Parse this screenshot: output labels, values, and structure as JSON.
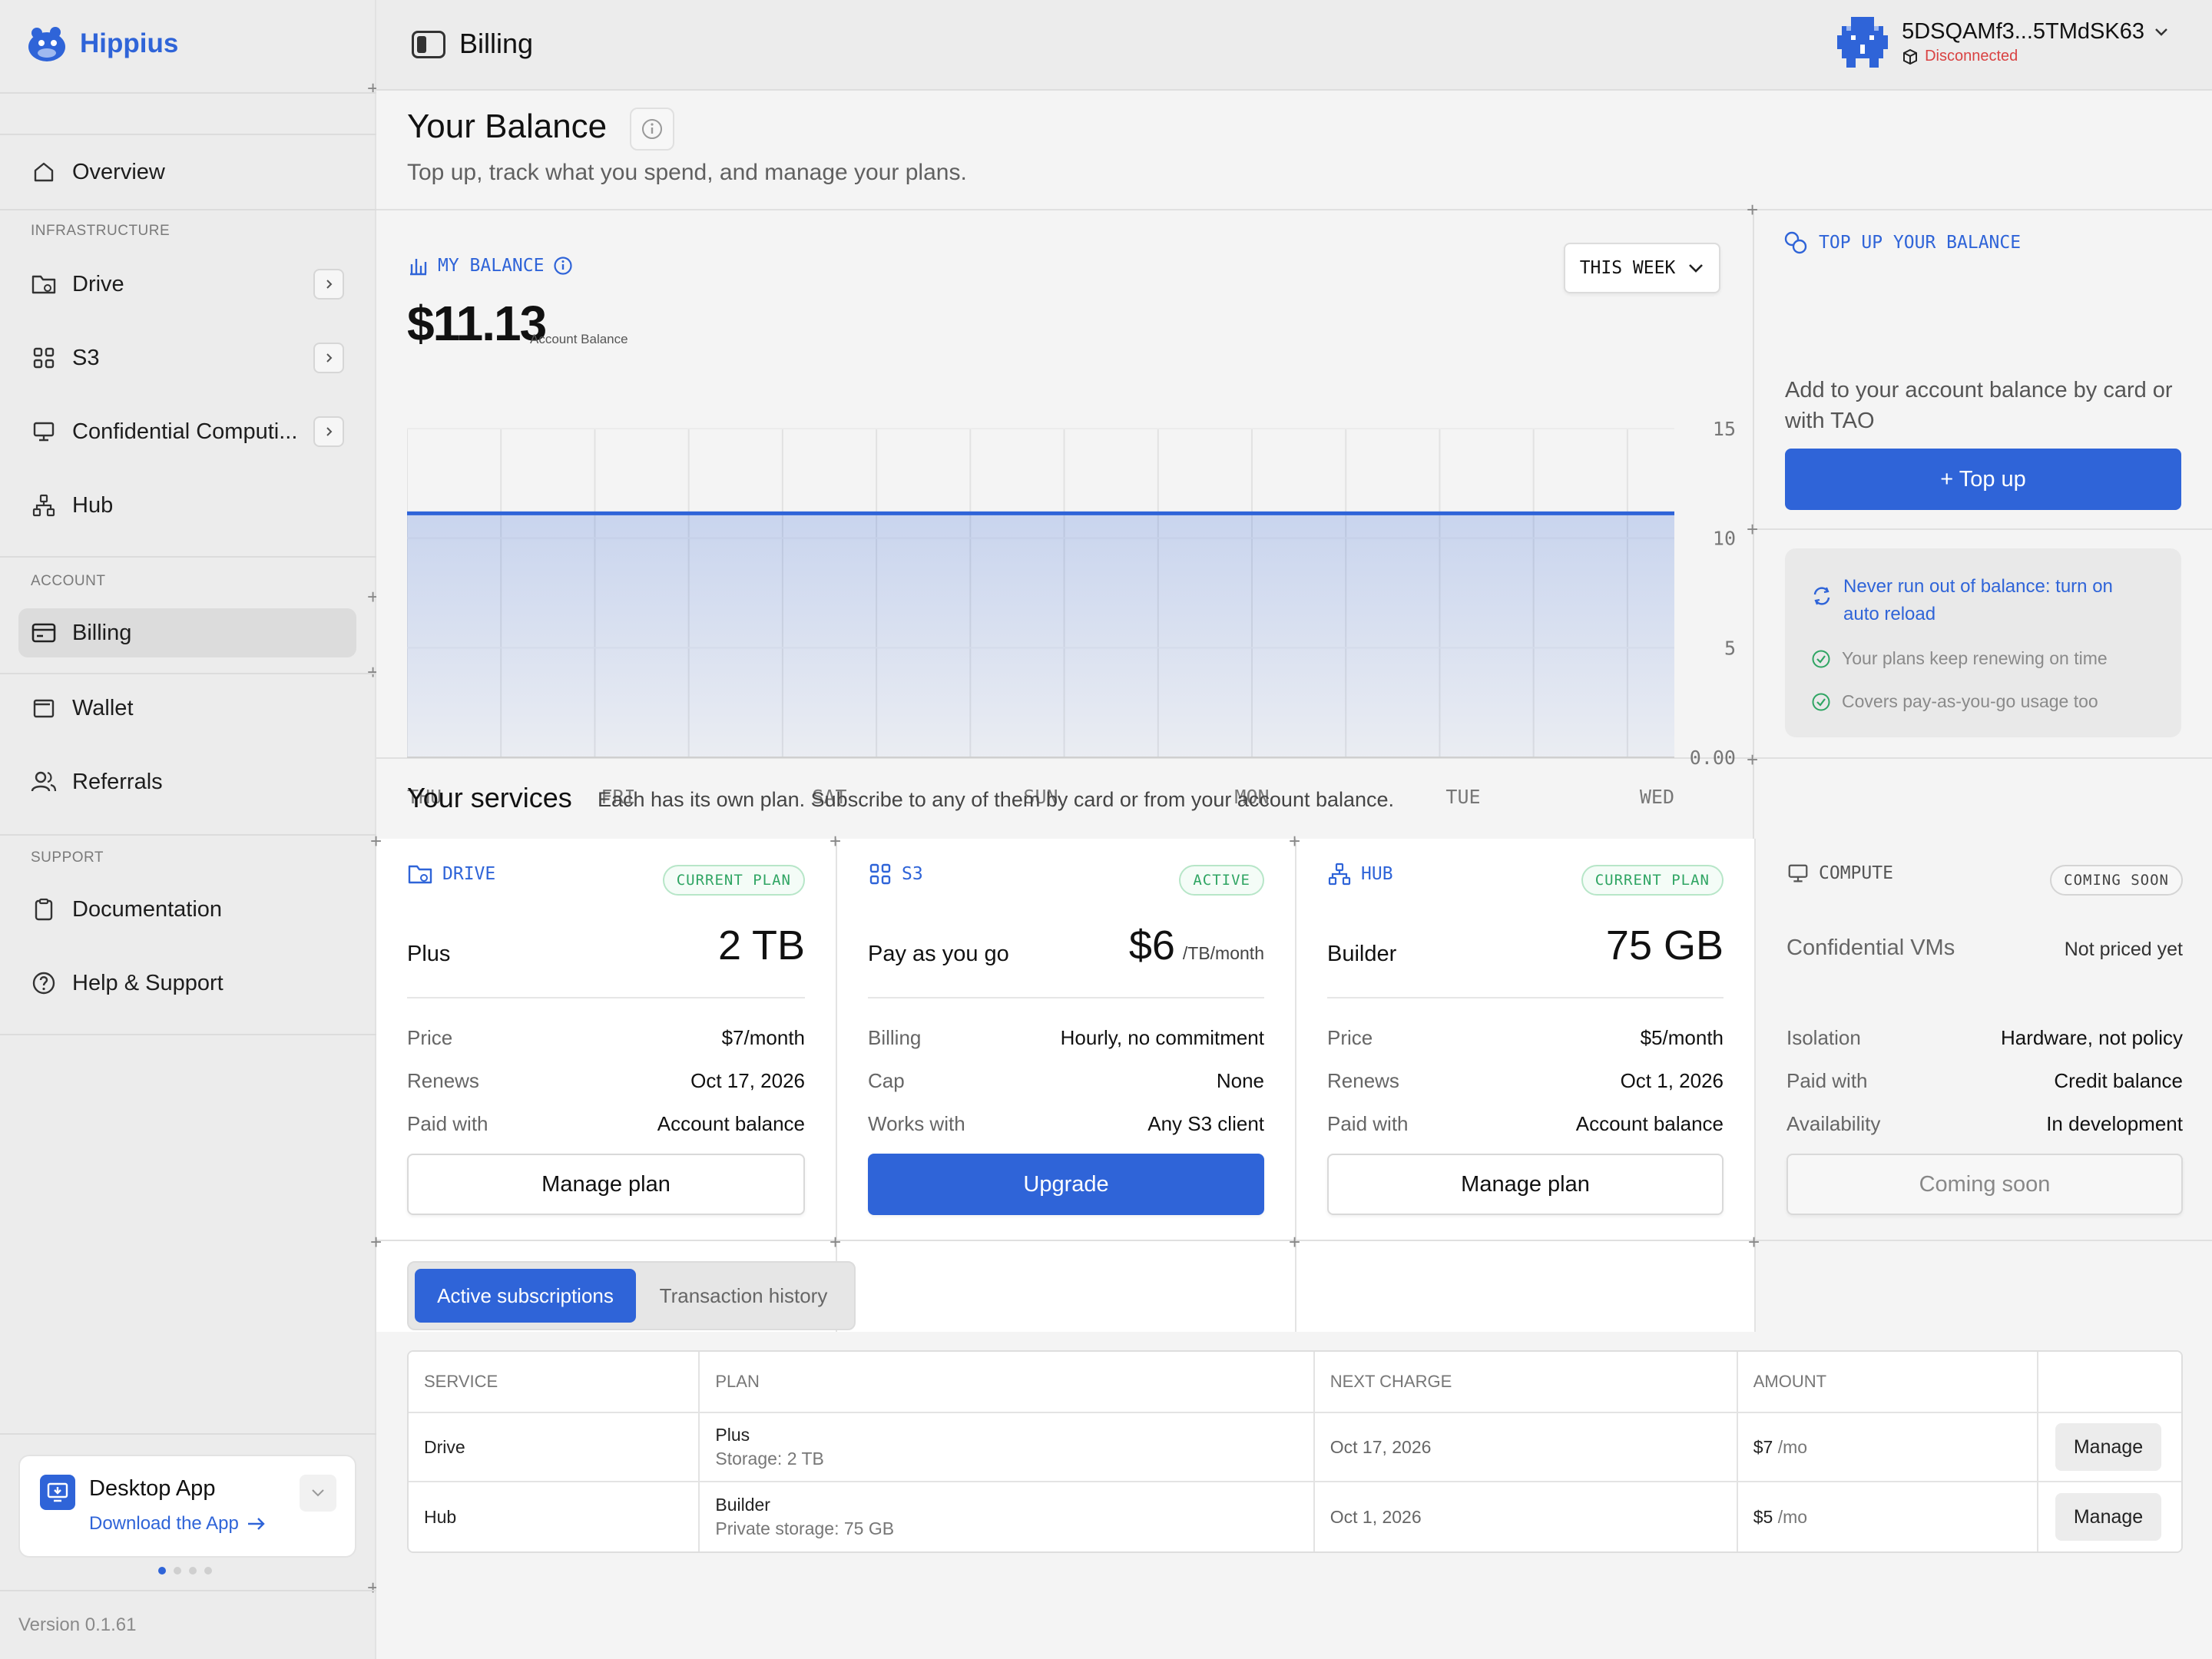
{
  "sidebar": {
    "brand": "Hippius",
    "items": [
      {
        "label": "Overview"
      },
      {
        "label": "Drive"
      },
      {
        "label": "S3"
      },
      {
        "label": "Confidential Computi..."
      },
      {
        "label": "Hub"
      },
      {
        "label": "Billing"
      },
      {
        "label": "Wallet"
      },
      {
        "label": "Referrals"
      },
      {
        "label": "Documentation"
      },
      {
        "label": "Help & Support"
      }
    ],
    "sections": {
      "infrastructure": "INFRASTRUCTURE",
      "account": "ACCOUNT",
      "support": "SUPPORT"
    },
    "desktop": {
      "title": "Desktop App",
      "link": "Download the App"
    },
    "version": "Version 0.1.61"
  },
  "topbar": {
    "title": "Billing",
    "address": "5DSQAMf3...5TMdSK63",
    "status": "Disconnected"
  },
  "page": {
    "title": "Your Balance",
    "subtitle": "Top up, track what you spend, and manage your plans."
  },
  "balance": {
    "label": "MY BALANCE",
    "value": "$11.13",
    "note": "Account Balance",
    "range": "THIS WEEK"
  },
  "chart_data": {
    "type": "area",
    "x": [
      "THU",
      "FRI",
      "SAT",
      "SUN",
      "MON",
      "TUE",
      "WED"
    ],
    "series": [
      {
        "values": [
          11.13,
          11.13,
          11.13,
          11.13,
          11.13,
          11.13,
          11.13
        ]
      }
    ],
    "ylim": [
      0,
      15
    ],
    "yticks": [
      "15",
      "10",
      "5",
      "0.00"
    ],
    "grid": true,
    "color": "#2f64d8"
  },
  "topup": {
    "label": "TOP UP YOUR BALANCE",
    "desc": "Add to your account balance by card or with TAO",
    "button": "+ Top up",
    "reload": "Never run out of balance: turn on auto reload",
    "bullets": [
      "Your plans keep renewing on time",
      "Covers pay-as-you-go usage too"
    ]
  },
  "services": {
    "title": "Your services",
    "subtitle": "Each has its own plan. Subscribe to any of them by card or from your account balance.",
    "cards": [
      {
        "name": "DRIVE",
        "badge": "CURRENT PLAN",
        "plan": "Plus",
        "amount": "2 TB",
        "unit": "",
        "rows": [
          [
            "Price",
            "$7/month"
          ],
          [
            "Renews",
            "Oct 17, 2026"
          ],
          [
            "Paid with",
            "Account balance"
          ]
        ],
        "button": "Manage plan"
      },
      {
        "name": "S3",
        "badge": "ACTIVE",
        "plan": "Pay as you go",
        "amount": "$6",
        "unit": "/TB/month",
        "rows": [
          [
            "Billing",
            "Hourly, no commitment"
          ],
          [
            "Cap",
            "None"
          ],
          [
            "Works with",
            "Any S3 client"
          ]
        ],
        "button": "Upgrade"
      },
      {
        "name": "HUB",
        "badge": "CURRENT PLAN",
        "plan": "Builder",
        "amount": "75 GB",
        "unit": "",
        "rows": [
          [
            "Price",
            "$5/month"
          ],
          [
            "Renews",
            "Oct 1, 2026"
          ],
          [
            "Paid with",
            "Account balance"
          ]
        ],
        "button": "Manage plan"
      },
      {
        "name": "COMPUTE",
        "badge": "COMING SOON",
        "plan": "Confidential VMs",
        "amount": "Not priced yet",
        "unit": "",
        "rows": [
          [
            "Isolation",
            "Hardware, not policy"
          ],
          [
            "Paid with",
            "Credit balance"
          ],
          [
            "Availability",
            "In development"
          ]
        ],
        "button": "Coming soon"
      }
    ]
  },
  "tabs": [
    "Active subscriptions",
    "Transaction history"
  ],
  "table": {
    "headers": [
      "SERVICE",
      "PLAN",
      "NEXT CHARGE",
      "AMOUNT",
      ""
    ],
    "rows": [
      {
        "service": "Drive",
        "plan": "Plus",
        "detail": "Storage: 2 TB",
        "next": "Oct 17, 2026",
        "amount": "$7",
        "per": "/mo",
        "action": "Manage"
      },
      {
        "service": "Hub",
        "plan": "Builder",
        "detail": "Private storage: 75 GB",
        "next": "Oct 1, 2026",
        "amount": "$5",
        "per": "/mo",
        "action": "Manage"
      }
    ]
  }
}
